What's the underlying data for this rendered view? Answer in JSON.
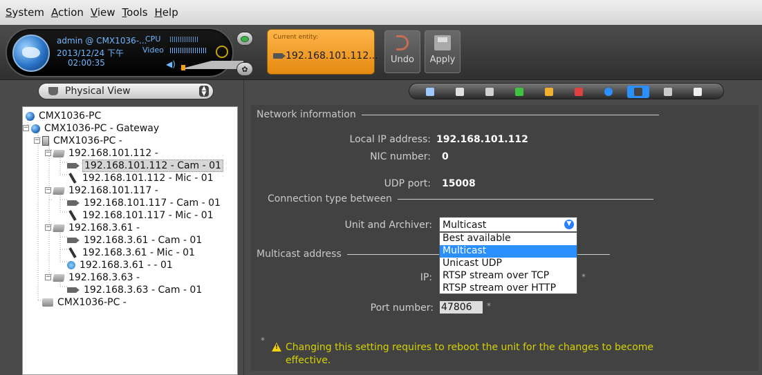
{
  "menu": {
    "items": [
      {
        "pre": "",
        "u": "S",
        "post": "ystem"
      },
      {
        "pre": "",
        "u": "A",
        "post": "ction"
      },
      {
        "pre": "",
        "u": "V",
        "post": "iew"
      },
      {
        "pre": "",
        "u": "T",
        "post": "ools"
      },
      {
        "pre": "",
        "u": "H",
        "post": "elp"
      }
    ]
  },
  "status": {
    "user": "admin @ CMX1036-...",
    "date": "2013/12/24 下午",
    "time": "02:00:35",
    "cpu_label": "CPU",
    "video_label": "Video"
  },
  "entity": {
    "label": "Current entity:",
    "value": "192.168.101.112..."
  },
  "actions": {
    "undo": "Undo",
    "apply": "Apply"
  },
  "view_selector": {
    "value": "Physical View"
  },
  "tree": [
    {
      "text": "CMX1036-PC",
      "icon": "globe-icon",
      "depth": 0,
      "selected": false
    },
    {
      "text": "CMX1036-PC - Gateway",
      "icon": "gateway-icon",
      "depth": 1,
      "selected": false
    },
    {
      "text": "CMX1036-PC -",
      "icon": "server-icon",
      "depth": 2,
      "selected": false
    },
    {
      "text": "192.168.101.112 -",
      "icon": "unit-icon",
      "depth": 3,
      "selected": false
    },
    {
      "text": "192.168.101.112 - Cam - 01",
      "icon": "camera-icon",
      "depth": 4,
      "selected": true
    },
    {
      "text": "192.168.101.112 - Mic - 01",
      "icon": "microphone-icon",
      "depth": 4,
      "selected": false
    },
    {
      "text": "192.168.101.117 -",
      "icon": "unit-icon",
      "depth": 3,
      "selected": false
    },
    {
      "text": "192.168.101.117 - Cam - 01",
      "icon": "camera-icon",
      "depth": 4,
      "selected": false
    },
    {
      "text": "192.168.101.117 - Mic - 01",
      "icon": "microphone-icon",
      "depth": 4,
      "selected": false
    },
    {
      "text": "192.168.3.61 -",
      "icon": "unit-icon",
      "depth": 3,
      "selected": false
    },
    {
      "text": "192.168.3.61 - Cam - 01",
      "icon": "camera-icon",
      "depth": 4,
      "selected": false
    },
    {
      "text": "192.168.3.61 - Mic - 01",
      "icon": "microphone-icon",
      "depth": 4,
      "selected": false
    },
    {
      "text": "192.168.3.61 -       - 01",
      "icon": "speaker-icon",
      "depth": 4,
      "selected": false
    },
    {
      "text": "192.168.3.63 -",
      "icon": "unit-icon",
      "depth": 3,
      "selected": false
    },
    {
      "text": "192.168.3.63 - Cam - 01",
      "icon": "camera-icon",
      "depth": 4,
      "selected": false
    },
    {
      "text": "CMX1036-PC -",
      "icon": "archiver-icon",
      "depth": 2,
      "selected": false
    }
  ],
  "tabs": [
    {
      "name": "identity-tab-icon",
      "color": "#9ec9ff"
    },
    {
      "name": "properties-tab-icon",
      "color": "#e0e0e0"
    },
    {
      "name": "peripherals-tab-icon",
      "color": "#d0d0d0"
    },
    {
      "name": "hardware-tab-icon",
      "color": "#3ec43e"
    },
    {
      "name": "color-tab-icon",
      "color": "#f0b030"
    },
    {
      "name": "video-tab-icon",
      "color": "#e04040"
    },
    {
      "name": "info-tab-icon",
      "color": "#2a8fff"
    },
    {
      "name": "network-tab-icon",
      "color": "#444444",
      "active": true
    },
    {
      "name": "tools-tab-icon",
      "color": "#cccccc"
    },
    {
      "name": "status-tab-icon",
      "color": "#eeeeee"
    }
  ],
  "network": {
    "section_title": "Network information",
    "local_ip_label": "Local IP address:",
    "local_ip_value": "192.168.101.112",
    "nic_label": "NIC number:",
    "nic_value": "0",
    "udp_label": "UDP port:",
    "udp_value": "15008"
  },
  "connection": {
    "section_title": "Connection type between",
    "field_label": "Unit and Archiver:",
    "selected": "Multicast",
    "options": [
      "Best available",
      "Multicast",
      "Unicast UDP",
      "RTSP stream over TCP",
      "RTSP stream over HTTP"
    ],
    "highlighted_index": 1
  },
  "multicast": {
    "section_title": "Multicast address",
    "ip_label": "IP:",
    "ip_star": "*",
    "port_label": "Port number:",
    "port_value": "47806",
    "port_star": "*"
  },
  "warning": {
    "star": "*",
    "text": "Changing this setting requires to reboot the unit for the changes to become effective."
  }
}
